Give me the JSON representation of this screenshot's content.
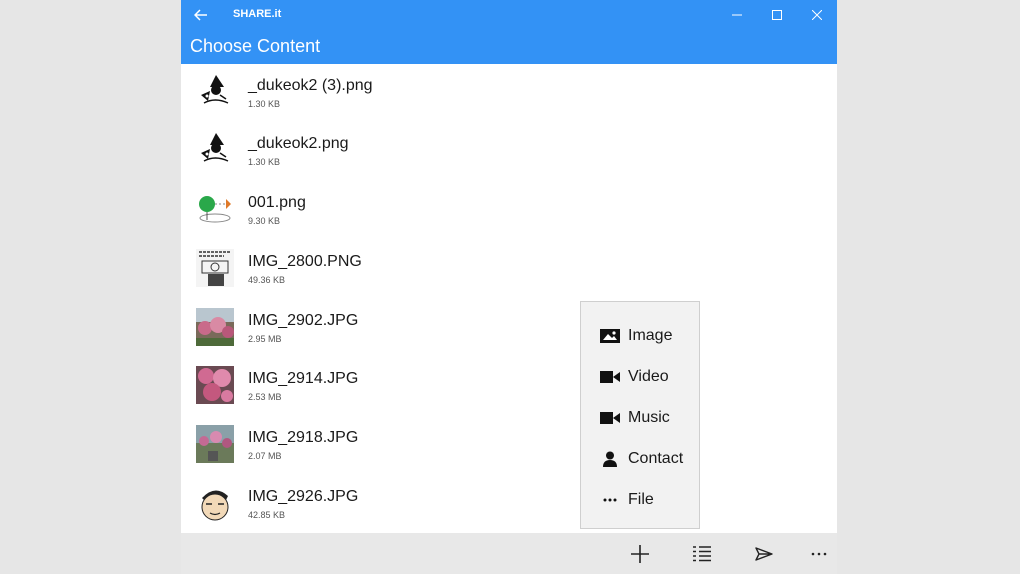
{
  "window": {
    "app_title": "SHARE.it",
    "page_title": "Choose Content"
  },
  "files": [
    {
      "name": "_dukeok2 (3).png",
      "size": "1.30  KB",
      "thumb": "duke-drawing-thumbnail"
    },
    {
      "name": "_dukeok2.png",
      "size": "1.30  KB",
      "thumb": "duke-drawing-thumbnail"
    },
    {
      "name": "001.png",
      "size": "9.30  KB",
      "thumb": "green-ball-thumbnail"
    },
    {
      "name": "IMG_2800.PNG",
      "size": "49.36  KB",
      "thumb": "comic-thumbnail"
    },
    {
      "name": "IMG_2902.JPG",
      "size": "2.95  MB",
      "thumb": "flower-photo-thumbnail"
    },
    {
      "name": "IMG_2914.JPG",
      "size": "2.53  MB",
      "thumb": "flower-photo-thumbnail"
    },
    {
      "name": "IMG_2918.JPG",
      "size": "2.07  MB",
      "thumb": "flower-photo-thumbnail"
    },
    {
      "name": "IMG_2926.JPG",
      "size": "42.85  KB",
      "thumb": "cartoon-face-thumbnail"
    }
  ],
  "menu": {
    "items": [
      {
        "label": "Image",
        "icon": "image-icon"
      },
      {
        "label": "Video",
        "icon": "video-camera-icon"
      },
      {
        "label": "Music",
        "icon": "video-camera-icon"
      },
      {
        "label": "Contact",
        "icon": "person-icon"
      },
      {
        "label": "File",
        "icon": "more-dots-icon"
      }
    ]
  },
  "appbar": {
    "buttons": [
      "add-icon",
      "list-view-icon",
      "send-icon",
      "more-icon"
    ]
  },
  "colors": {
    "accent": "#3392f5",
    "content_bg": "#ffffff",
    "menu_bg": "#f2f2f2",
    "appbar_bg": "#e8e8e8"
  }
}
